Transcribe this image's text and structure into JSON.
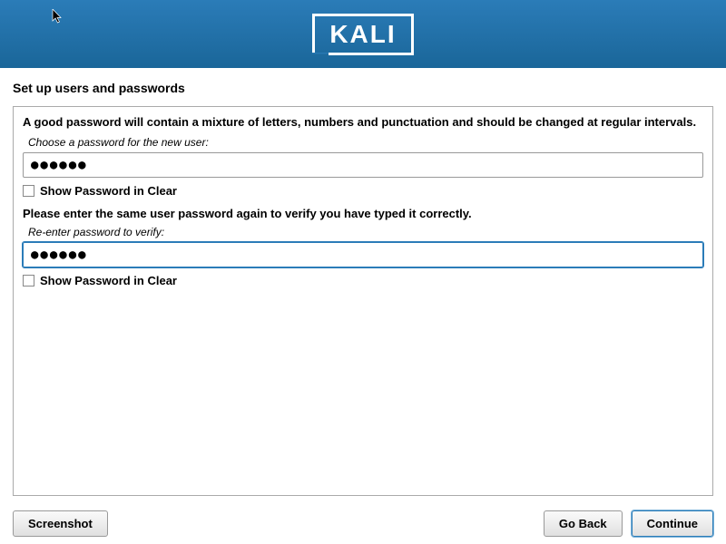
{
  "header": {
    "logo_text": "KALI"
  },
  "page": {
    "title": "Set up users and passwords",
    "intro": "A good password will contain a mixture of letters, numbers and punctuation and should be changed at regular intervals.",
    "password1": {
      "label": "Choose a password for the new user:",
      "value": "●●●●●●",
      "show_label": "Show Password in Clear"
    },
    "verify_text": "Please enter the same user password again to verify you have typed it correctly.",
    "password2": {
      "label": "Re-enter password to verify:",
      "value": "●●●●●●",
      "show_label": "Show Password in Clear"
    }
  },
  "buttons": {
    "screenshot": "Screenshot",
    "go_back": "Go Back",
    "continue": "Continue"
  }
}
